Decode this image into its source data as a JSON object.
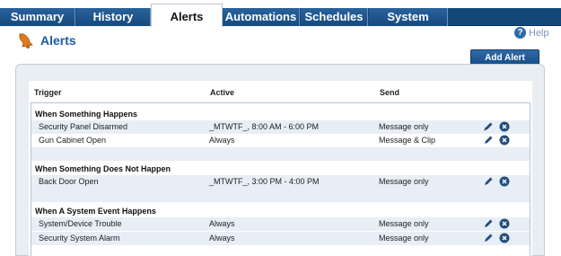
{
  "tabs": [
    {
      "label": "Summary",
      "active": false
    },
    {
      "label": "History",
      "active": false
    },
    {
      "label": "Alerts",
      "active": true
    },
    {
      "label": "Automations",
      "active": false
    },
    {
      "label": "Schedules",
      "active": false
    },
    {
      "label": "System",
      "active": false
    }
  ],
  "header": {
    "title": "Alerts",
    "icon": "bell-icon",
    "help_label": "Help",
    "help_icon": "question-circle-icon"
  },
  "add_alert_label": "Add Alert",
  "columns": {
    "trigger": "Trigger",
    "active": "Active",
    "send": "Send"
  },
  "groups": [
    {
      "title": "When Something Happens",
      "rows": [
        {
          "trigger": "Security Panel Disarmed",
          "active": "_MTWTF_, 8:00 AM - 6:00 PM",
          "send": "Message only"
        },
        {
          "trigger": "Gun Cabinet Open",
          "active": "Always",
          "send": "Message & Clip"
        }
      ]
    },
    {
      "title": "When Something Does Not Happen",
      "rows": [
        {
          "trigger": "Back Door Open",
          "active": "_MTWTF_, 3:00 PM - 4:00 PM",
          "send": "Message only"
        }
      ]
    },
    {
      "title": "When A System Event Happens",
      "rows": [
        {
          "trigger": "System/Device Trouble",
          "active": "Always",
          "send": "Message only"
        },
        {
          "trigger": "Security System Alarm",
          "active": "Always",
          "send": "Message only"
        }
      ]
    }
  ],
  "row_icons": {
    "edit": "pencil-icon",
    "delete": "close-circle-icon"
  },
  "colors": {
    "tab_bar": "#14467a",
    "title": "#1a5ba6",
    "row_shade": "#e7eef5",
    "icon": "#234d7e"
  }
}
